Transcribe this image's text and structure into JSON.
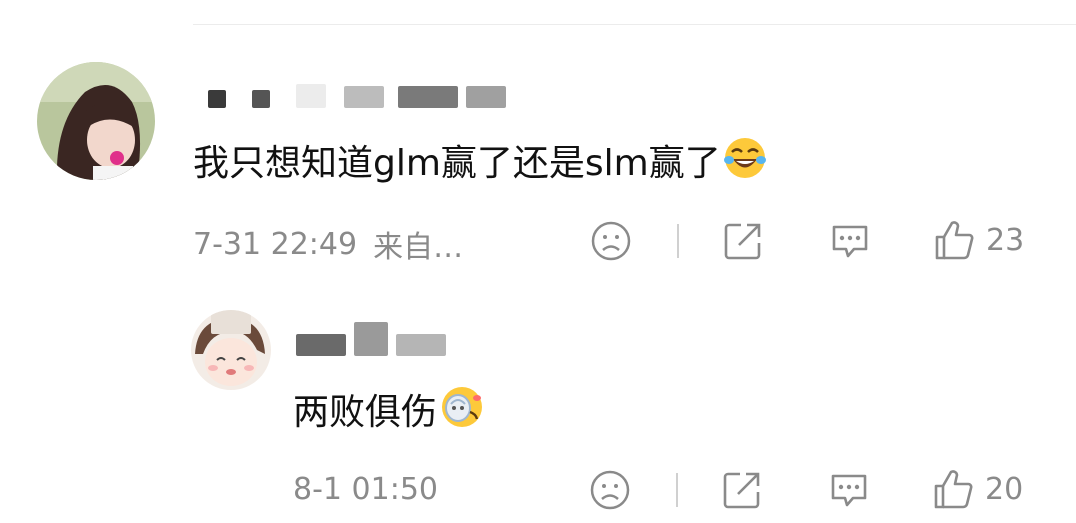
{
  "comments": [
    {
      "text": "我只想知道glm赢了还是slm赢了",
      "emoji": "laughing-crying-emoji",
      "time": "7-31 22:49",
      "source": "来自…",
      "likes": "23"
    },
    {
      "text": "两败俱伤",
      "emoji": "dizzy-face-emoji",
      "time": "8-1 01:50",
      "likes": "20"
    }
  ],
  "icons": {
    "dislike": "frown-face-icon",
    "share": "share-arrow-icon",
    "reply": "comment-bubble-icon",
    "like": "thumbs-up-icon"
  },
  "colors": {
    "text": "#111111",
    "meta": "#8a8a8a",
    "divider": "#ececec"
  }
}
